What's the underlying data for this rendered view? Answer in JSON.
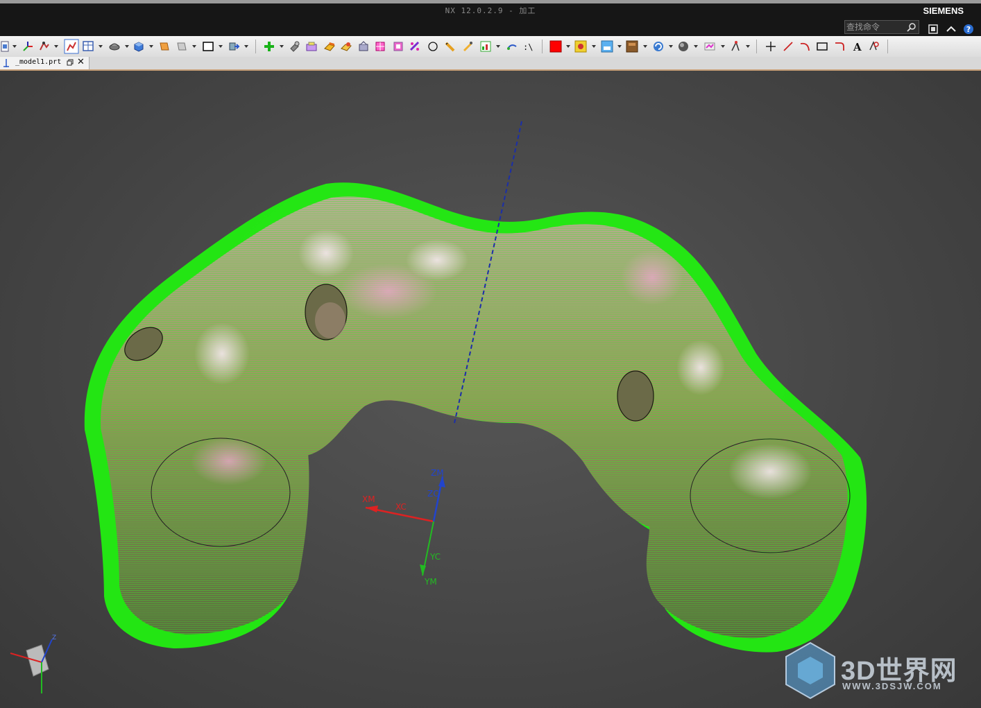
{
  "window": {
    "title": "NX 12.0.2.9 - 加工",
    "brand": "SIEMENS"
  },
  "command_finder": {
    "placeholder": "查找命令"
  },
  "title_buttons": [
    "fit-window-icon",
    "collapse-ribbon-icon",
    "help-icon"
  ],
  "tabs": [
    {
      "label": "_model1.prt",
      "active": true
    }
  ],
  "toolbar": {
    "icons": [
      "new-file-icon",
      "csys-icon",
      "operation-icon",
      "edit-display-icon",
      "table-icon",
      "geometry-icon",
      "block-icon",
      "select-icon",
      "select-filter-icon",
      "rectangle-icon",
      "transform-icon",
      "add-icon",
      "tool-icon",
      "program-icon",
      "machining-icon",
      "method-icon",
      "geometry-view-icon",
      "feature-icon",
      "pocket-icon",
      "wizard-icon",
      "circle-icon",
      "pencil-icon",
      "measure-icon",
      "process-icon",
      "edit-icon",
      "analysis-icon",
      "color-icon",
      "settings-icon",
      "display-icon",
      "material-icon",
      "refresh-icon",
      "shade-icon",
      "simulate-icon",
      "cam-icon",
      "point-icon",
      "line-icon",
      "arc-icon",
      "rect-icon",
      "fillet-icon",
      "text-icon",
      "annotation-icon"
    ],
    "accent_color": "#ff0000"
  },
  "viewport": {
    "axis_labels": {
      "xm": "XM",
      "xc": "XC",
      "zm": "ZM",
      "zc": "ZC",
      "yc": "YC",
      "ym": "YM"
    },
    "mini_triad_labels": {
      "z": "Z"
    },
    "toolpath_color": "#22ee11",
    "axis_colors": {
      "x": "#dd2222",
      "y": "#22bb22",
      "z": "#2244cc"
    }
  },
  "watermark": {
    "main": "3D世界网",
    "sub": "WWW.3DSJW.COM"
  }
}
